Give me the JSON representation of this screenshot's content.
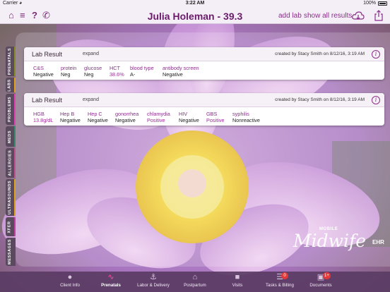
{
  "status_bar": {
    "carrier": "Carrier",
    "time": "3:22 AM",
    "battery": "100%"
  },
  "header": {
    "title": "Julia Holeman - 39.3",
    "add_lab": "add lab",
    "show_all": "show all results",
    "icons": [
      "home-icon",
      "list-icon",
      "help-icon",
      "phone-icon",
      "cloud-download-icon",
      "share-icon"
    ]
  },
  "side_tabs": [
    {
      "label": "PRENATALS",
      "color": "#8a8a2a"
    },
    {
      "label": "LABS",
      "color": "#e0a020"
    },
    {
      "label": "PROBLEMS",
      "color": "#e040b0"
    },
    {
      "label": "MEDS",
      "color": "#3a8a6a"
    },
    {
      "label": "ALLERGIES",
      "color": "#c05090"
    },
    {
      "label": "ULTRASOUNDS",
      "color": "#e0a020"
    },
    {
      "label": "XFER",
      "color": "#c040a0"
    },
    {
      "label": "MESSAGES",
      "color": "#5a4a5e"
    }
  ],
  "cards": [
    {
      "title": "Lab Result",
      "expand": "expand",
      "created": "created by Stacy Smith on 8/12/16, 3:19 AM",
      "info": "i",
      "tests": [
        {
          "name": "C&S",
          "value": "Negative",
          "abnormal": false
        },
        {
          "name": "protein",
          "value": "Neg",
          "abnormal": false
        },
        {
          "name": "glucose",
          "value": "Neg",
          "abnormal": false
        },
        {
          "name": "HCT",
          "value": "38.6%",
          "abnormal": true
        },
        {
          "name": "blood type",
          "value": "A-",
          "abnormal": false
        },
        {
          "name": "antibody screen",
          "value": "Negative",
          "abnormal": false
        }
      ]
    },
    {
      "title": "Lab Result",
      "expand": "expand",
      "created": "created by Stacy Smith on 8/12/16, 3:19 AM",
      "info": "i",
      "tests": [
        {
          "name": "HGB",
          "value": "13.8g/dL",
          "abnormal": true
        },
        {
          "name": "Hep B",
          "value": "Negative",
          "abnormal": false
        },
        {
          "name": "Hep C",
          "value": "Negative",
          "abnormal": false
        },
        {
          "name": "gonorrhea",
          "value": "Negative",
          "abnormal": false
        },
        {
          "name": "chlamydia",
          "value": "Positive",
          "abnormal": true
        },
        {
          "name": "HIV",
          "value": "Negative",
          "abnormal": false
        },
        {
          "name": "GBS",
          "value": "Positive",
          "abnormal": true
        },
        {
          "name": "syphilis",
          "value": "Nonreactive",
          "abnormal": false
        }
      ]
    }
  ],
  "logo": {
    "mobile": "MOBILE",
    "midwife": "Midwife",
    "ehr": "EHR"
  },
  "tab_bar": [
    {
      "label": "Client Info",
      "icon": "person-icon",
      "active": false,
      "badge": ""
    },
    {
      "label": "Prenatals",
      "icon": "heartbeat-icon",
      "active": true,
      "badge": ""
    },
    {
      "label": "Labor & Delivery",
      "icon": "stroller-icon",
      "active": false,
      "badge": ""
    },
    {
      "label": "Postpartum",
      "icon": "house-icon",
      "active": false,
      "badge": ""
    },
    {
      "label": "Visits",
      "icon": "car-icon",
      "active": false,
      "badge": ""
    },
    {
      "label": "Tasks & Billing",
      "icon": "tasks-icon",
      "active": false,
      "badge": "0"
    },
    {
      "label": "Documents",
      "icon": "documents-icon",
      "active": false,
      "badge": "1+"
    }
  ]
}
